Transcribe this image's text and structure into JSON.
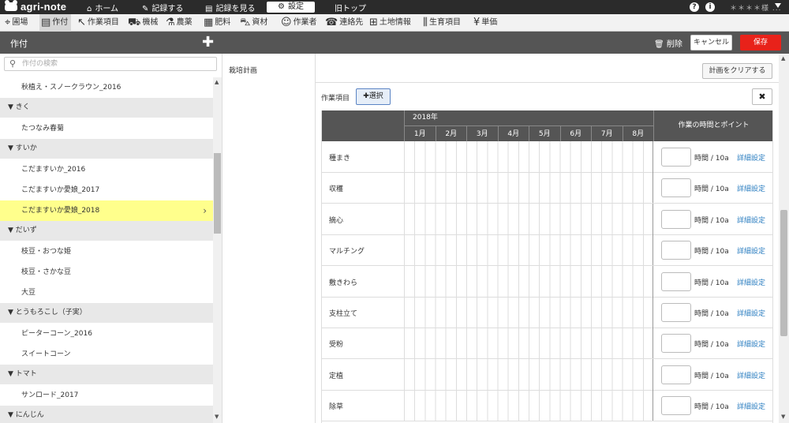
{
  "topbar": {
    "logo": "agri-note",
    "nav": [
      {
        "icon": "home-icon",
        "glyph": "⌂",
        "label": "ホーム"
      },
      {
        "icon": "pencil-icon",
        "glyph": "✎",
        "label": "記録する"
      },
      {
        "icon": "book-icon",
        "glyph": "▤",
        "label": "記録を見る"
      },
      {
        "icon": "gear-icon",
        "glyph": "⚙",
        "label": "設定"
      },
      {
        "icon": "",
        "glyph": "",
        "label": "旧トップ"
      }
    ],
    "help_glyph": "?",
    "info_glyph": "i",
    "user_name": "＊＊＊＊様 ..."
  },
  "subnav": [
    {
      "icon": "map-pin-icon",
      "glyph": "⌖",
      "label": "圃場"
    },
    {
      "icon": "notebook-icon",
      "glyph": "▤",
      "label": "作付"
    },
    {
      "icon": "hoe-icon",
      "glyph": "↖",
      "label": "作業項目"
    },
    {
      "icon": "tractor-icon",
      "glyph": "⛟",
      "label": "機械"
    },
    {
      "icon": "flask-icon",
      "glyph": "⚗",
      "label": "農薬"
    },
    {
      "icon": "fertilizer-icon",
      "glyph": "▦",
      "label": "肥料"
    },
    {
      "icon": "wheelbarrow-icon",
      "glyph": "⛍",
      "label": "資材"
    },
    {
      "icon": "worker-icon",
      "glyph": "☺",
      "label": "作業者"
    },
    {
      "icon": "phone-icon",
      "glyph": "☎",
      "label": "連絡先"
    },
    {
      "icon": "land-icon",
      "glyph": "⊞",
      "label": "土地情報"
    },
    {
      "icon": "growth-icon",
      "glyph": "⫼",
      "label": "生育項目"
    },
    {
      "icon": "yen-icon",
      "glyph": "¥",
      "label": "単価"
    }
  ],
  "header": {
    "title": "作付",
    "add_glyph": "✚",
    "delete_label": "削除",
    "cancel_label": "キャンセル",
    "save_label": "保存"
  },
  "search": {
    "placeholder": "作付の検索",
    "value": ""
  },
  "list": [
    {
      "type": "item",
      "label": "秋植え・スノークラウン_2016"
    },
    {
      "type": "group",
      "label": "▼ きく"
    },
    {
      "type": "item",
      "label": "たつなみ春菊"
    },
    {
      "type": "group",
      "label": "▼ すいか"
    },
    {
      "type": "item",
      "label": "こだますいか_2016"
    },
    {
      "type": "item",
      "label": "こだますいか愛娘_2017"
    },
    {
      "type": "item",
      "label": "こだますいか愛娘_2018",
      "selected": true
    },
    {
      "type": "group",
      "label": "▼ だいず"
    },
    {
      "type": "item",
      "label": "枝豆・おつな姫"
    },
    {
      "type": "item",
      "label": "枝豆・さかな豆"
    },
    {
      "type": "item",
      "label": "大豆"
    },
    {
      "type": "group",
      "label": "▼ とうもろこし（子実）"
    },
    {
      "type": "item",
      "label": "ピーターコーン_2016"
    },
    {
      "type": "item",
      "label": "スイートコーン"
    },
    {
      "type": "group",
      "label": "▼ トマト"
    },
    {
      "type": "item",
      "label": "サンロード_2017"
    },
    {
      "type": "group",
      "label": "▼ にんじん"
    }
  ],
  "plan_label": "栽培計画",
  "content": {
    "clear_label": "計画をクリアする",
    "work_label": "作業項目",
    "select_label": "✚選択",
    "close_glyph": "✖",
    "year": "2018年",
    "months": [
      "1月",
      "2月",
      "3月",
      "4月",
      "5月",
      "6月",
      "7月",
      "8月"
    ],
    "time_header": "作業の時間とポイント",
    "unit_label": "時間 / 10a",
    "detail_label": "詳細設定",
    "tasks": [
      "種まき",
      "収穫",
      "摘心",
      "マルチング",
      "敷きわら",
      "支柱立て",
      "受粉",
      "定植",
      "除草"
    ]
  },
  "colors": {
    "save": "#e8221a",
    "selected_row": "#ffff8c",
    "link": "#2d7fc1",
    "header": "#555555"
  }
}
